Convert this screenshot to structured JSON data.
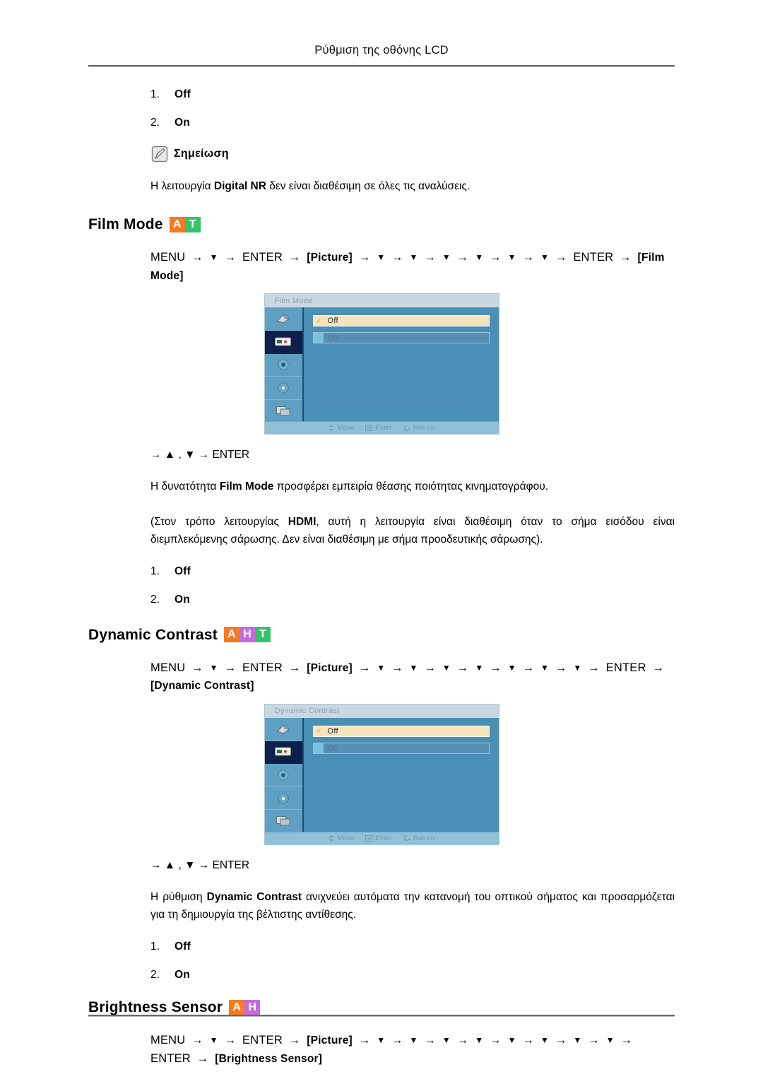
{
  "header": {
    "title": "Ρύθμιση της οθόνης LCD"
  },
  "top_options": [
    {
      "num": "1.",
      "value": "Off"
    },
    {
      "num": "2.",
      "value": "On"
    }
  ],
  "note": {
    "icon": "note-pencil-icon",
    "label": "Σημείωση",
    "text_prefix": "Η λειτουργία ",
    "text_bold": "Digital NR",
    "text_suffix": " δεν είναι διαθέσιμη σε όλες τις αναλύσεις."
  },
  "badge_colors": {
    "A": "#f47b20",
    "H": "#c76ae0",
    "T": "#33c46a"
  },
  "osd_common": {
    "options": [
      {
        "label": "Off",
        "selected": true,
        "mark": "✔"
      },
      {
        "label": "On",
        "selected": false,
        "mark": ""
      }
    ],
    "footer": [
      {
        "icon": "move-icon",
        "label": "Move"
      },
      {
        "icon": "enter-icon",
        "label": "Enter"
      },
      {
        "icon": "return-icon",
        "label": "Return"
      }
    ],
    "sidebar_icons": [
      "input-source-icon",
      "picture-icon",
      "sound-icon",
      "setup-icon",
      "multi-control-icon"
    ],
    "selected_sidebar_index": 1
  },
  "sections": [
    {
      "id": "film-mode",
      "title": "Film Mode",
      "badges": [
        "A",
        "T"
      ],
      "path": {
        "menu": "MENU",
        "enter1": "ENTER",
        "bracket1": "[Picture]",
        "down_count_label": "▼",
        "down_count": 6,
        "enter2": "ENTER",
        "bracket2": "[Film Mode]",
        "arrow": "→"
      },
      "osd_title": "Film Mode",
      "after_path": "→ ▲ , ▼ → ENTER",
      "paragraphs": [
        {
          "prefix": "Η δυνατότητα ",
          "bold": "Film Mode",
          "suffix": " προσφέρει εμπειρία θέασης ποιότητας κινηματογράφου."
        },
        {
          "prefix": "(Στον τρόπο λειτουργίας ",
          "bold": "HDMI",
          "suffix": ", αυτή η λειτουργία είναι διαθέσιμη όταν το σήμα εισόδου είναι διεμπλεκόμενης σάρωσης. Δεν είναι διαθέσιμη με σήμα προοδευτικής σάρωσης)."
        }
      ],
      "options": [
        {
          "num": "1.",
          "value": "Off"
        },
        {
          "num": "2.",
          "value": "On"
        }
      ]
    },
    {
      "id": "dynamic-contrast",
      "title": "Dynamic Contrast",
      "badges": [
        "A",
        "H",
        "T"
      ],
      "path": {
        "menu": "MENU",
        "enter1": "ENTER",
        "bracket1": "[Picture]",
        "down_count_label": "▼",
        "down_count": 7,
        "enter2": "ENTER",
        "bracket2": "[Dynamic Contrast]",
        "arrow": "→"
      },
      "osd_title": "Dynamic Contrast",
      "after_path": "→ ▲ , ▼ → ENTER",
      "paragraphs": [
        {
          "prefix": "Η ρύθμιση ",
          "bold": "Dynamic Contrast",
          "suffix": " ανιχνεύει αυτόματα την κατανομή του οπτικού σήματος και προσαρμόζεται για τη δημιουργία της βέλτιστης αντίθεσης."
        }
      ],
      "options": [
        {
          "num": "1.",
          "value": "Off"
        },
        {
          "num": "2.",
          "value": "On"
        }
      ]
    },
    {
      "id": "brightness-sensor",
      "title": "Brightness Sensor",
      "badges": [
        "A",
        "H"
      ],
      "path": {
        "menu": "MENU",
        "enter1": "ENTER",
        "bracket1": "[Picture]",
        "down_count_label": "▼",
        "down_count": 8,
        "enter2": "ENTER",
        "bracket2": "[Brightness Sensor]",
        "arrow": "→"
      },
      "osd_title": "",
      "after_path": "",
      "paragraphs": [],
      "options": []
    }
  ]
}
